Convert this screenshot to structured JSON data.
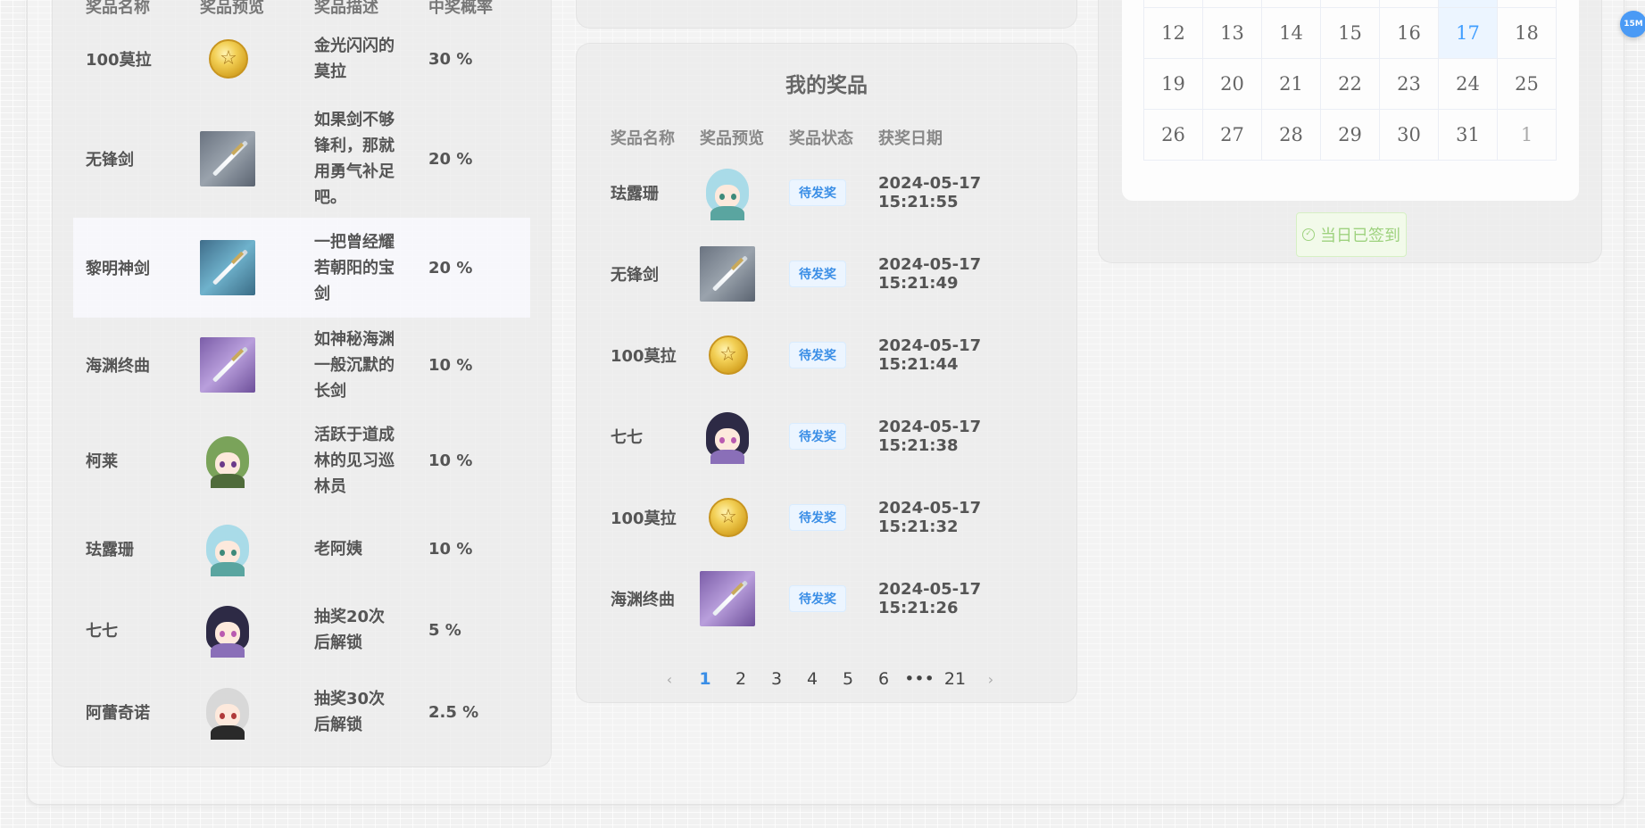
{
  "pool": {
    "headers": [
      "奖品名称",
      "奖品预览",
      "奖品描述",
      "中奖概率"
    ],
    "rows": [
      {
        "name": "100莫拉",
        "preview": "mora-coin-icon",
        "desc": "金光闪闪的莫拉",
        "rate": "30 %"
      },
      {
        "name": "无锋剑",
        "preview": "dull-blade-sword-icon",
        "desc": "如果剑不够锋利，那就用勇气补足吧。",
        "rate": "20 %"
      },
      {
        "name": "黎明神剑",
        "preview": "harbinger-of-dawn-sword-icon",
        "desc": "一把曾经耀若朝阳的宝剑",
        "rate": "20 %"
      },
      {
        "name": "海渊终曲",
        "preview": "finale-of-the-deep-sword-icon",
        "desc": "如神秘海渊一般沉默的长剑",
        "rate": "10 %"
      },
      {
        "name": "柯莱",
        "preview": "collei-avatar",
        "desc": "活跃于道成林的见习巡林员",
        "rate": "10 %"
      },
      {
        "name": "珐露珊",
        "preview": "faruzan-avatar",
        "desc": "老阿姨",
        "rate": "10 %"
      },
      {
        "name": "七七",
        "preview": "qiqi-avatar",
        "desc": "抽奖20次后解锁",
        "rate": "5 %"
      },
      {
        "name": "阿蕾奇诺",
        "preview": "arlecchino-avatar",
        "desc": "抽奖30次后解锁",
        "rate": "2.5 %"
      }
    ]
  },
  "my_prizes": {
    "title": "我的奖品",
    "headers": [
      "奖品名称",
      "奖品预览",
      "奖品状态",
      "获奖日期"
    ],
    "rows": [
      {
        "name": "珐露珊",
        "preview": "faruzan-avatar",
        "status": "待发奖",
        "date": "2024-05-17 15:21:55"
      },
      {
        "name": "无锋剑",
        "preview": "dull-blade-sword-icon",
        "status": "待发奖",
        "date": "2024-05-17 15:21:49"
      },
      {
        "name": "100莫拉",
        "preview": "mora-coin-icon",
        "status": "待发奖",
        "date": "2024-05-17 15:21:44"
      },
      {
        "name": "七七",
        "preview": "qiqi-avatar",
        "status": "待发奖",
        "date": "2024-05-17 15:21:38"
      },
      {
        "name": "100莫拉",
        "preview": "mora-coin-icon",
        "status": "待发奖",
        "date": "2024-05-17 15:21:32"
      },
      {
        "name": "海渊终曲",
        "preview": "finale-of-the-deep-sword-icon",
        "status": "待发奖",
        "date": "2024-05-17 15:21:26"
      }
    ],
    "pagination": {
      "prev": "‹",
      "pages": [
        "1",
        "2",
        "3",
        "4",
        "5",
        "6",
        "•••",
        "21"
      ],
      "current": "1",
      "next": "›"
    }
  },
  "calendar": {
    "rows": [
      [
        "12",
        "13",
        "14",
        "15",
        "16",
        "17",
        "18"
      ],
      [
        "19",
        "20",
        "21",
        "22",
        "23",
        "24",
        "25"
      ],
      [
        "26",
        "27",
        "28",
        "29",
        "30",
        "31",
        "1"
      ]
    ],
    "today": "17",
    "accent": "#409eff"
  },
  "checkin": {
    "label": "当日已签到",
    "icon": "check-circle-icon",
    "color": "#9ed27f"
  },
  "floating_badge": {
    "label": "15M"
  }
}
